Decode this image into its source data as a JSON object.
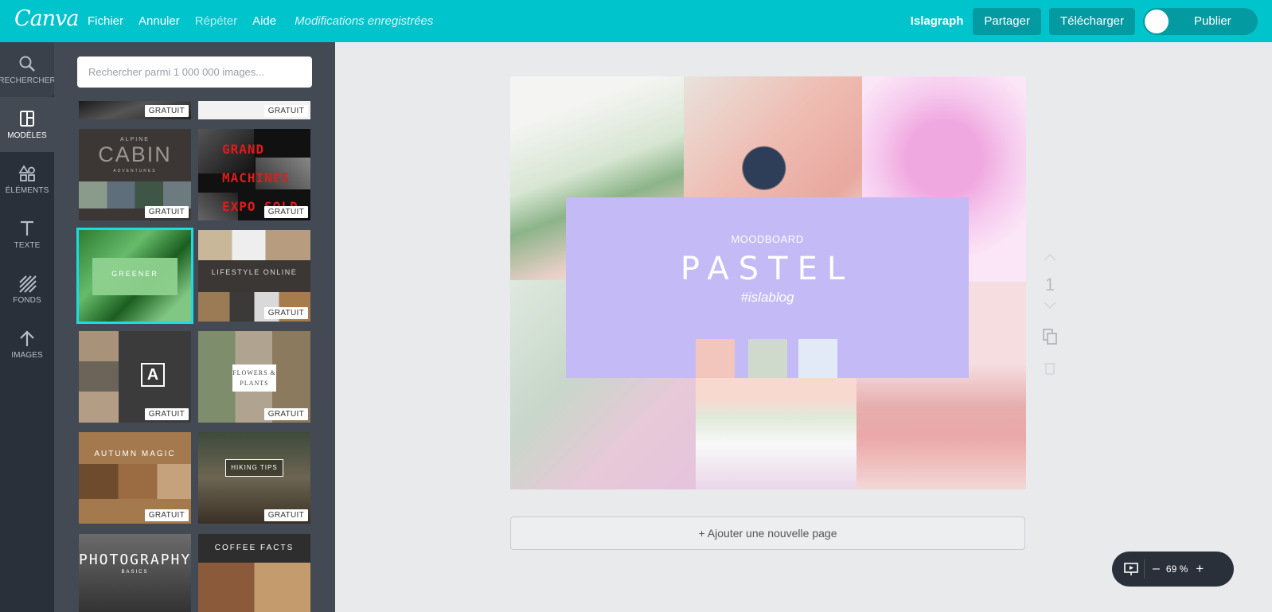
{
  "app": {
    "logo": "Canva",
    "menu": [
      "Fichier",
      "Annuler",
      "Répéter",
      "Aide"
    ],
    "save_status": "Modifications enregistrées",
    "team_name": "Islagraph",
    "share_label": "Partager",
    "download_label": "Télécharger",
    "publish_label": "Publier"
  },
  "sidebar": {
    "items": [
      {
        "label": "RECHERCHER",
        "icon": "search-icon"
      },
      {
        "label": "MODÈLES",
        "icon": "templates-icon"
      },
      {
        "label": "ÉLÉMENTS",
        "icon": "shapes-icon"
      },
      {
        "label": "TEXTE",
        "icon": "text-icon"
      },
      {
        "label": "FONDS",
        "icon": "background-icon"
      },
      {
        "label": "IMAGES",
        "icon": "upload-icon"
      }
    ]
  },
  "panel": {
    "search_placeholder": "Rechercher parmi 1 000 000 images...",
    "badge": "GRATUIT",
    "templates": [
      {
        "title": "",
        "badge": "GRATUIT"
      },
      {
        "title": "",
        "badge": "GRATUIT"
      },
      {
        "title": "CABIN",
        "kicker": "ALPINE",
        "sub": "ADVENTURES",
        "badge": "GRATUIT"
      },
      {
        "title": "GRAND MACHINES EXPO SOLD",
        "badge": "GRATUIT"
      },
      {
        "title": "GREENER",
        "badge": ""
      },
      {
        "title": "LIFESTYLE ONLINE",
        "badge": "GRATUIT"
      },
      {
        "title": "A",
        "badge": "GRATUIT"
      },
      {
        "title": "FLOWERS & PLANTS",
        "badge": "GRATUIT"
      },
      {
        "title": "AUTUMN MAGIC",
        "badge": "GRATUIT"
      },
      {
        "title": "HIKING TIPS",
        "badge": "GRATUIT"
      },
      {
        "title": "PHOTOGRAPHY",
        "sub": "BASICS",
        "badge": ""
      },
      {
        "title": "COFFEE FACTS",
        "badge": ""
      }
    ]
  },
  "design": {
    "subtitle": "MOODBOARD",
    "title": "PASTEL",
    "tag": "#islablog",
    "colors": {
      "overlay": "#c4baf5",
      "swatches": [
        "#f3c6bd",
        "#cfd9cc",
        "#e3eaf7"
      ]
    }
  },
  "page_controls": {
    "page_number": "1"
  },
  "add_page_label": "+ Ajouter une nouvelle page",
  "zoom": {
    "level": "69 %"
  }
}
